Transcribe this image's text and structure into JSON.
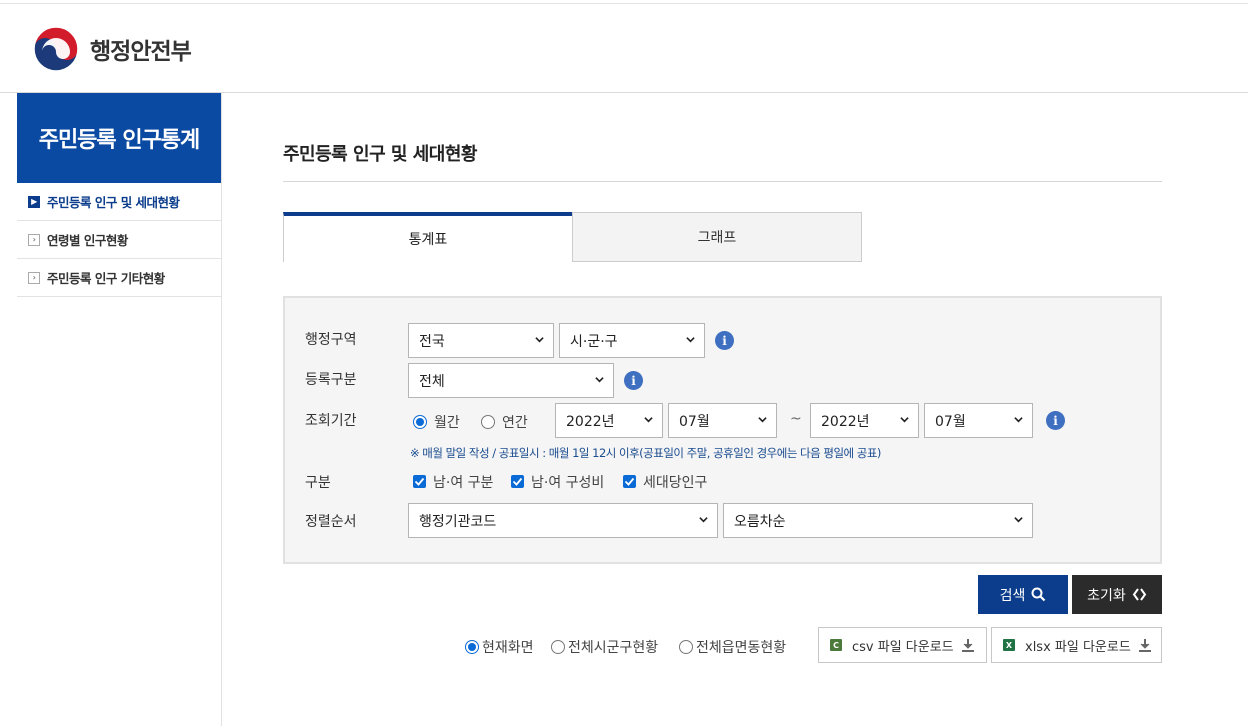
{
  "header": {
    "org_name": "행정안전부"
  },
  "sidebar": {
    "title": "주민등록 인구통계",
    "items": [
      {
        "label": "주민등록 인구 및 세대현황",
        "active": true
      },
      {
        "label": "연령별 인구현황",
        "active": false
      },
      {
        "label": "주민등록 인구 기타현황",
        "active": false
      }
    ]
  },
  "main": {
    "title": "주민등록 인구 및 세대현황",
    "tabs": [
      {
        "label": "통계표",
        "active": true
      },
      {
        "label": "그래프",
        "active": false
      }
    ]
  },
  "form": {
    "region": {
      "label": "행정구역",
      "sido": "전국",
      "sigungu": "시·군·구"
    },
    "registration": {
      "label": "등록구분",
      "value": "전체"
    },
    "period": {
      "label": "조회기간",
      "monthly_label": "월간",
      "yearly_label": "연간",
      "selected": "월간",
      "from_year": "2022년",
      "from_month": "07월",
      "separator": "~",
      "to_year": "2022년",
      "to_month": "07월",
      "note": "※ 매월 말일 작성 / 공표일시 : 매월 1일 12시 이후(공표일이 주말, 공휴일인 경우에는 다음 평일에 공표)"
    },
    "category": {
      "label": "구분",
      "options": [
        {
          "label": "남·여 구분",
          "checked": true
        },
        {
          "label": "남·여 구성비",
          "checked": true
        },
        {
          "label": "세대당인구",
          "checked": true
        }
      ]
    },
    "sort": {
      "label": "정렬순서",
      "field": "행정기관코드",
      "order": "오름차순"
    }
  },
  "actions": {
    "search": "검색",
    "reset": "초기화"
  },
  "view": {
    "options": [
      {
        "label": "현재화면",
        "selected": true
      },
      {
        "label": "전체시군구현황",
        "selected": false
      },
      {
        "label": "전체읍면동현황",
        "selected": false
      }
    ]
  },
  "downloads": {
    "csv": {
      "icon": "C",
      "label": "csv 파일 다운로드"
    },
    "xlsx": {
      "icon": "X",
      "label": "xlsx 파일 다운로드"
    }
  },
  "colors": {
    "primary": "#0b3d8c",
    "sidebar_title": "#0b4aa2",
    "note": "#1a4c8f",
    "info": "#3e6fc0",
    "reset_button": "#2b2b2b"
  },
  "icons": [
    "government-emblem-icon",
    "info-icon",
    "chevron-down-icon",
    "search-icon",
    "reset-icon",
    "download-icon",
    "csv-file-icon",
    "xlsx-file-icon"
  ]
}
